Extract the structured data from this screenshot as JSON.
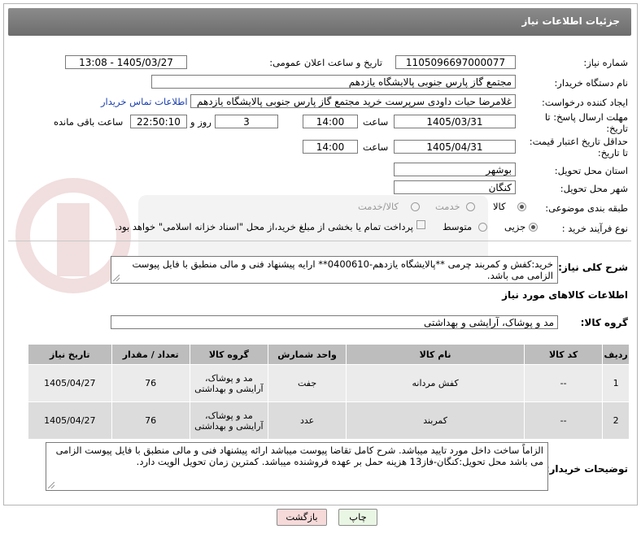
{
  "header": {
    "title": "جزئیات اطلاعات نیاز"
  },
  "form": {
    "need_number": {
      "label": "شماره نیاز:",
      "value": "1105096697000077"
    },
    "announce_datetime": {
      "label": "تاریخ و ساعت اعلان عمومی:",
      "value": "1405/03/27 - 13:08"
    },
    "buyer_org": {
      "label": "نام دستگاه خریدار:",
      "value": "مجتمع گاز پارس جنوبی  پالایشگاه یازدهم"
    },
    "requester": {
      "label": "ایجاد کننده درخواست:",
      "value": "غلامرضا حیات داودی سرپرست خرید مجتمع گاز پارس جنوبی  پالایشگاه یازدهم",
      "contact_link": "اطلاعات تماس خریدار"
    },
    "reply_deadline": {
      "label_line1": "مهلت ارسال پاسخ: تا",
      "label_line2": "تاریخ:",
      "date": "1405/03/31",
      "time_label": "ساعت",
      "time": "14:00",
      "days": "3",
      "days_label": "روز و",
      "remaining": "22:50:10",
      "remaining_label": "ساعت باقی مانده"
    },
    "price_validity": {
      "label_line1": "حداقل تاریخ اعتبار قیمت:",
      "label_line2": "تا تاریخ:",
      "date": "1405/04/31",
      "time_label": "ساعت",
      "time": "14:00"
    },
    "province": {
      "label": "استان محل تحویل:",
      "value": "بوشهر"
    },
    "city": {
      "label": "شهر محل تحویل:",
      "value": "کنگان"
    },
    "category": {
      "label": "طبقه بندی موضوعی:",
      "options": [
        "کالا",
        "خدمت",
        "کالا/خدمت"
      ],
      "selected": "کالا"
    },
    "purchase_type": {
      "label": "نوع فرآیند خرید :",
      "options": [
        "جزیی",
        "متوسط"
      ],
      "selected": "جزیی",
      "payment_note": "پرداخت تمام یا بخشی از مبلغ خرید،از محل \"اسناد خزانه اسلامی\" خواهد بود."
    }
  },
  "description": {
    "label": "شرح کلی نیاز:",
    "text": "خرید:کفش و کمربند چرمی **پالایشگاه یازدهم-0400610** ارایه پیشنهاد فنی و مالی منطبق با فایل پیوست الزامی می باشد."
  },
  "goods_info": {
    "title": "اطلاعات کالاهای مورد نیاز",
    "group_label": "گروه کالا:",
    "group_value": "مد و پوشاک، آرایشی و بهداشتی"
  },
  "table": {
    "headers": [
      "ردیف",
      "کد کالا",
      "نام کالا",
      "واحد شمارش",
      "گروه کالا",
      "تعداد / مقدار",
      "تاریخ نیاز"
    ],
    "rows": [
      [
        "1",
        "--",
        "کفش مردانه",
        "جفت",
        "مد و پوشاک، آرایشی و بهداشتی",
        "76",
        "1405/04/27"
      ],
      [
        "2",
        "--",
        "کمربند",
        "عدد",
        "مد و پوشاک، آرایشی و بهداشتی",
        "76",
        "1405/04/27"
      ]
    ]
  },
  "buyer_notes": {
    "label": "توضیحات خریدار:",
    "text": "الزاماً ساخت داخل مورد تایید میباشد. شرح کامل تقاضا پیوست میباشد ارائه پیشنهاد فنی و مالی منطبق با فایل پیوست الزامی می باشد محل تحویل:کنگان-فاز13 هزینه حمل بر عهده فروشنده میباشد. کمترین زمان تحویل الویت دارد."
  },
  "buttons": {
    "print": "چاپ",
    "back": "بازگشت"
  },
  "colors": {
    "header": "#7a7a7a",
    "link": "#1a3fb0",
    "back_button": "#f6d9d9",
    "print_button": "#eaf6e4"
  }
}
